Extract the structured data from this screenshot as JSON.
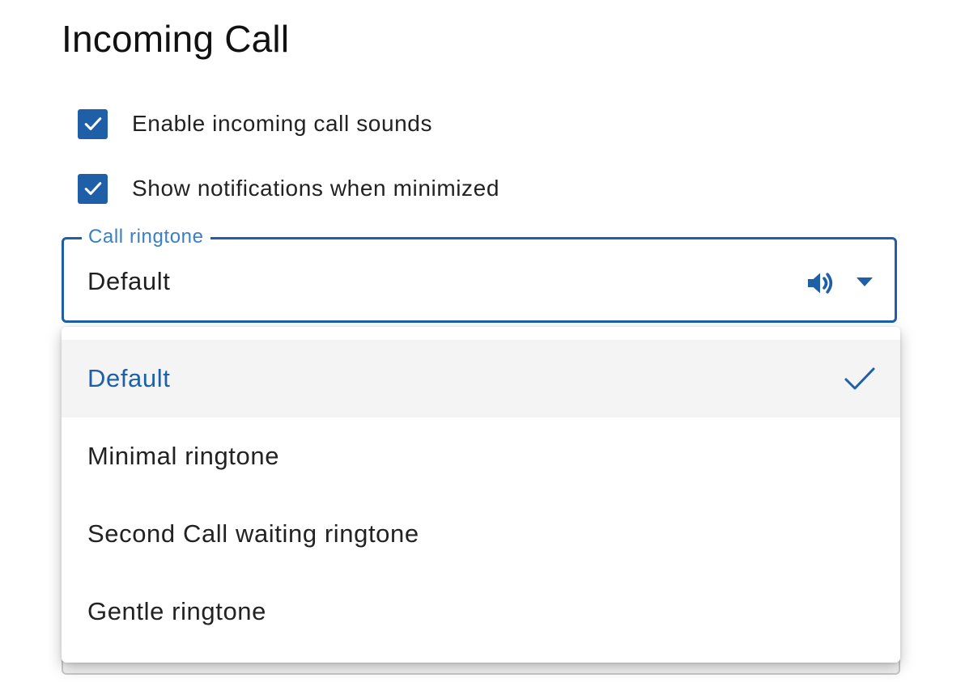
{
  "section": {
    "title": "Incoming Call"
  },
  "options": [
    {
      "label": "Enable incoming call sounds",
      "checked": true
    },
    {
      "label": "Show notifications when minimized",
      "checked": true
    }
  ],
  "ringtone_select": {
    "legend": "Call ringtone",
    "value": "Default",
    "icons": [
      "speaker-icon",
      "caret-down-icon"
    ],
    "menu_items": [
      {
        "label": "Default",
        "selected": true
      },
      {
        "label": "Minimal ringtone",
        "selected": false
      },
      {
        "label": "Second Call waiting ringtone",
        "selected": false
      },
      {
        "label": "Gentle ringtone",
        "selected": false
      }
    ]
  },
  "colors": {
    "accent": "#1e5fa8",
    "legend": "#3a7fc4",
    "selected_row_bg": "#f4f4f4"
  }
}
